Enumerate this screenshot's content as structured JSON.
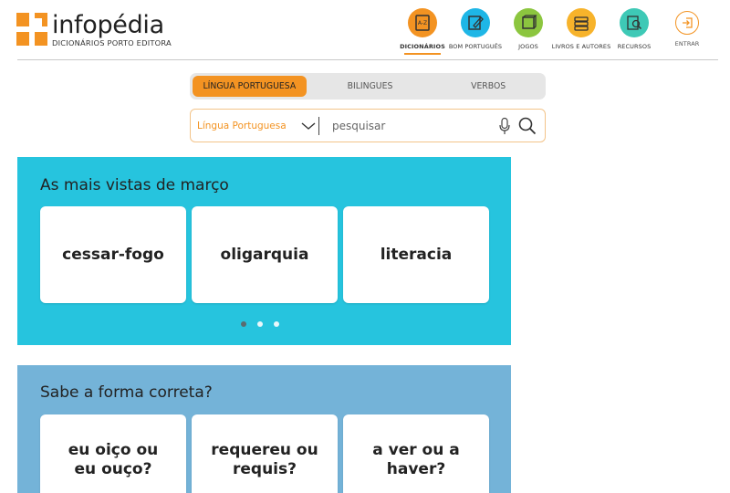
{
  "logo": {
    "name": "infopédia",
    "subtitle": "DICIONÁRIOS PORTO EDITORA"
  },
  "nav": [
    {
      "label": "DICIONÁRIOS",
      "icon": "dictionary-az-icon",
      "color": "#f39322",
      "active": true
    },
    {
      "label": "BOM PORTUGUÊS",
      "icon": "pencil-note-icon",
      "color": "#1eb6e6"
    },
    {
      "label": "JOGOS",
      "icon": "game-cube-icon",
      "color": "#8cc63f"
    },
    {
      "label": "LIVROS E AUTORES",
      "icon": "books-icon",
      "color": "#f7b32b"
    },
    {
      "label": "RECURSOS",
      "icon": "resources-search-icon",
      "color": "#3ec9b6"
    },
    {
      "label": "ENTRAR",
      "icon": "login-icon",
      "color": "#f39322"
    }
  ],
  "search": {
    "tabs": [
      "LÍNGUA PORTUGUESA",
      "BILINGUES",
      "VERBOS"
    ],
    "active_tab": "LÍNGUA PORTUGUESA",
    "language": "Língua Portuguesa",
    "placeholder": "pesquisar"
  },
  "most_viewed": {
    "title": "As mais vistas de março",
    "words": [
      "cessar-fogo",
      "oligarquia",
      "literacia"
    ],
    "carousel_pages": 3,
    "carousel_active": 1
  },
  "correct_form": {
    "title": "Sabe a forma correta?",
    "questions": [
      "eu oiço ou eu ouço?",
      "requereu ou requis?",
      "a ver ou a haver?"
    ]
  },
  "colors": {
    "accent": "#f39322",
    "panel_most_viewed": "#26c4de",
    "panel_correct_form": "#74b3d8"
  }
}
